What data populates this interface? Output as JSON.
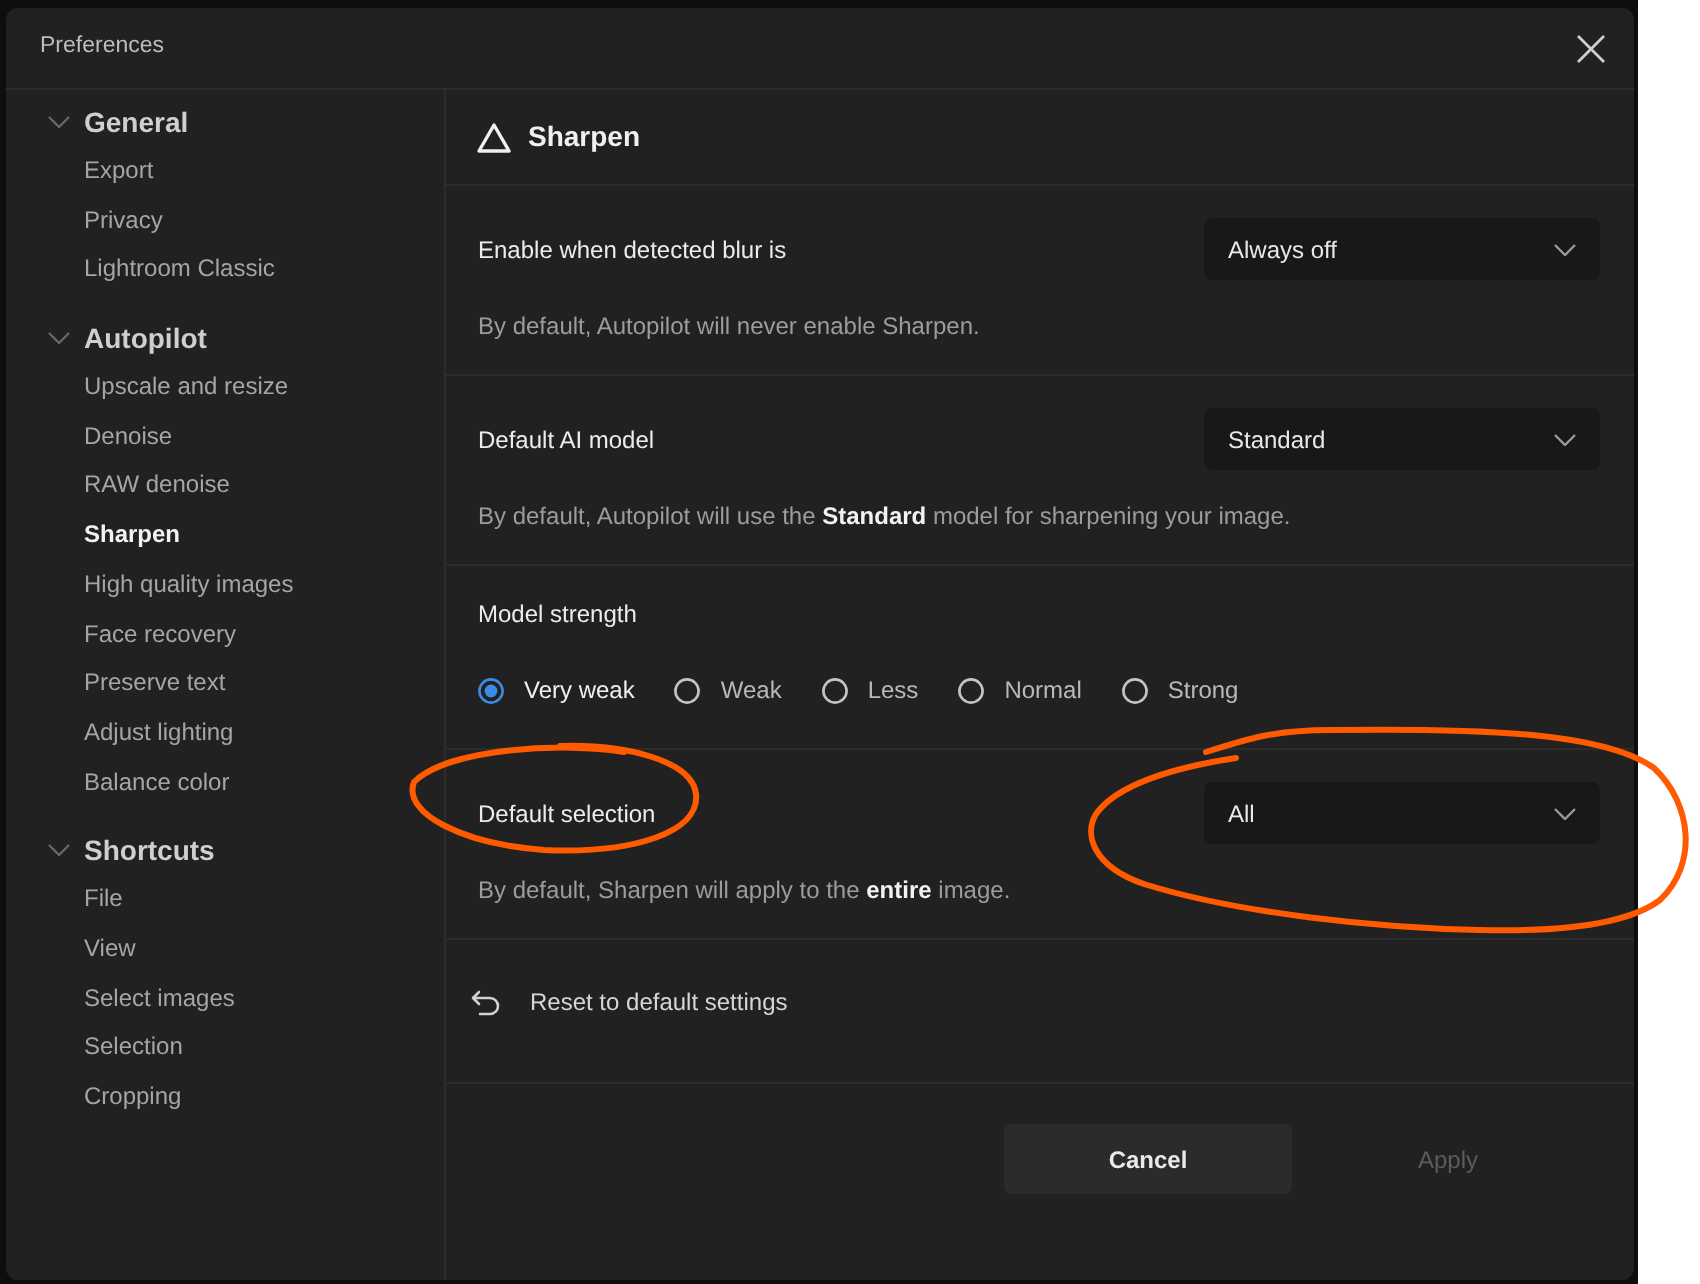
{
  "window": {
    "title": "Preferences"
  },
  "sidebar": {
    "groups": [
      {
        "label": "General",
        "expanded": true,
        "items": [
          {
            "label": "Export",
            "selected": false
          },
          {
            "label": "Privacy",
            "selected": false
          },
          {
            "label": "Lightroom Classic",
            "selected": false
          }
        ]
      },
      {
        "label": "Autopilot",
        "expanded": true,
        "items": [
          {
            "label": "Upscale and resize",
            "selected": false
          },
          {
            "label": "Denoise",
            "selected": false
          },
          {
            "label": "RAW denoise",
            "selected": false
          },
          {
            "label": "Sharpen",
            "selected": true
          },
          {
            "label": "High quality images",
            "selected": false
          },
          {
            "label": "Face recovery",
            "selected": false
          },
          {
            "label": "Preserve text",
            "selected": false
          },
          {
            "label": "Adjust lighting",
            "selected": false
          },
          {
            "label": "Balance color",
            "selected": false
          }
        ]
      },
      {
        "label": "Shortcuts",
        "expanded": true,
        "items": [
          {
            "label": "File",
            "selected": false
          },
          {
            "label": "View",
            "selected": false
          },
          {
            "label": "Select images",
            "selected": false
          },
          {
            "label": "Selection",
            "selected": false
          },
          {
            "label": "Cropping",
            "selected": false
          }
        ]
      }
    ]
  },
  "page": {
    "title": "Sharpen",
    "settings": [
      {
        "kind": "dropdown",
        "label": "Enable when detected blur is",
        "value": "Always off",
        "description": "By default, Autopilot will never enable Sharpen.",
        "circled_label": false,
        "circled_control": false
      },
      {
        "kind": "dropdown",
        "label": "Default AI model",
        "value": "Standard",
        "description": "By default, Autopilot will use the **Standard** model for sharpening your image.",
        "circled_label": false,
        "circled_control": false
      },
      {
        "kind": "radio",
        "label": "Model strength",
        "options": [
          {
            "label": "Very weak",
            "selected": true
          },
          {
            "label": "Weak",
            "selected": false
          },
          {
            "label": "Less",
            "selected": false
          },
          {
            "label": "Normal",
            "selected": false
          },
          {
            "label": "Strong",
            "selected": false
          }
        ],
        "circled_label": false,
        "circled_control": false
      },
      {
        "kind": "dropdown",
        "label": "Default selection",
        "value": "All",
        "description": "By default, Sharpen will apply to the **entire** image.",
        "circled_label": true,
        "circled_control": true
      }
    ],
    "reset": {
      "label": "Reset to default settings"
    }
  },
  "buttons": [
    {
      "label": "Cancel",
      "disabled": false
    },
    {
      "label": "Apply",
      "disabled": true
    }
  ]
}
